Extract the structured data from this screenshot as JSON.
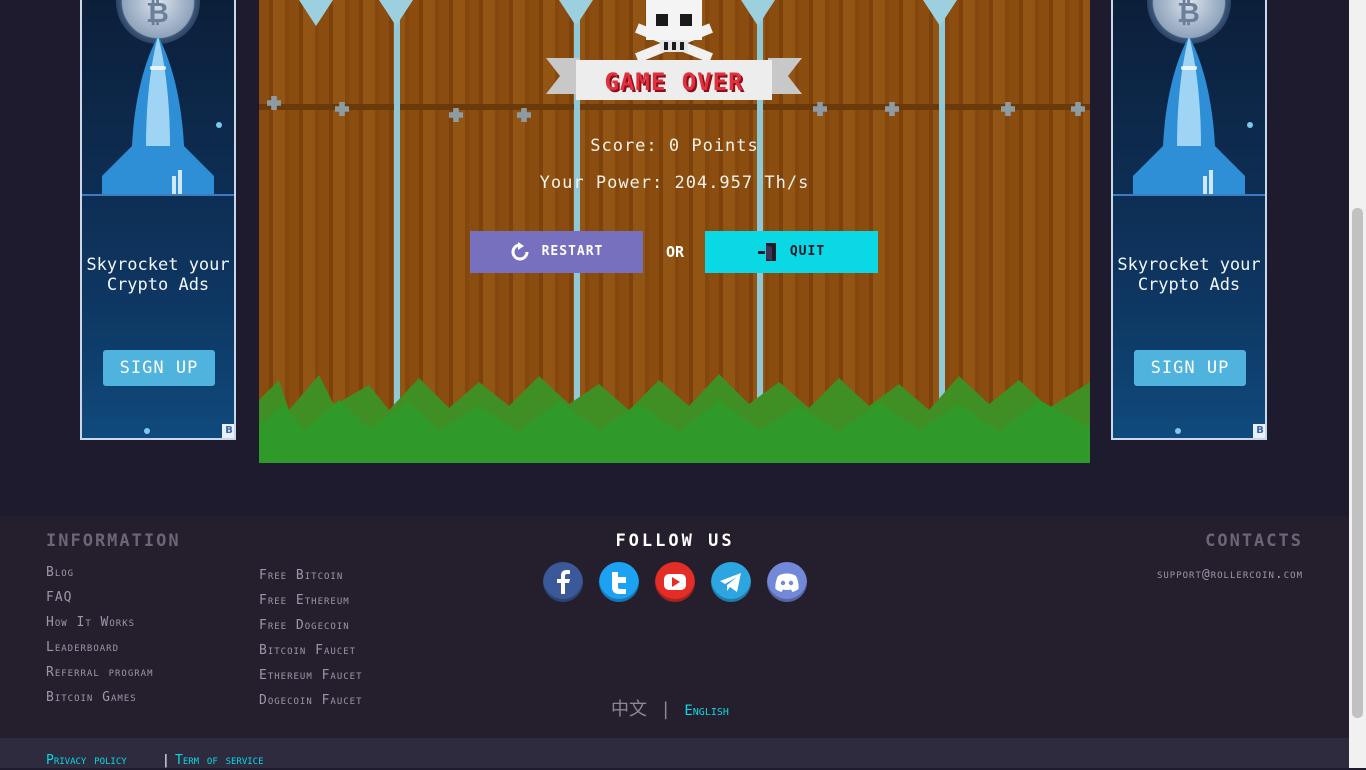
{
  "ads": {
    "left": {
      "text": "Skyrocket your Crypto Ads",
      "button": "SIGN UP",
      "badge": "B"
    },
    "right": {
      "text": "Skyrocket your Crypto Ads",
      "button": "SIGN UP",
      "badge": "B"
    }
  },
  "game": {
    "title": "GAME OVER",
    "score": "Score: 0 Points",
    "power": "Your Power: 204.957 Th/s",
    "restart_label": "RESTART",
    "or_label": "OR",
    "quit_label": "QUIT"
  },
  "footer": {
    "information_heading": "INFORMATION",
    "info_links": [
      "Blog",
      "FAQ",
      "How It Works",
      "Leaderboard",
      "Referral program",
      "Bitcoin Games"
    ],
    "crypto_links": [
      "Free Bitcoin",
      "Free Ethereum",
      "Free Dogecoin",
      "Bitcoin Faucet",
      "Ethereum Faucet",
      "Dogecoin Faucet"
    ],
    "follow_heading": "FOLLOW US",
    "socials": [
      {
        "name": "facebook-icon",
        "color": "#3b5998"
      },
      {
        "name": "twitter-icon",
        "color": "#1da1f2"
      },
      {
        "name": "youtube-icon",
        "color": "#e52d27"
      },
      {
        "name": "telegram-icon",
        "color": "#2ca5e0"
      },
      {
        "name": "discord-icon",
        "color": "#7289da"
      }
    ],
    "contacts_heading": "CONTACTS",
    "email": "support@rollercoin.com",
    "lang_zh": "中文",
    "lang_sep": "|",
    "lang_en": "English"
  },
  "bottom": {
    "privacy": "Privacy policy",
    "sep": "|",
    "terms": "Term of service"
  },
  "colors": {
    "accent_cyan": "#0ad8e4",
    "restart_purple": "#7670bf",
    "footer_bg": "#251f2d"
  }
}
